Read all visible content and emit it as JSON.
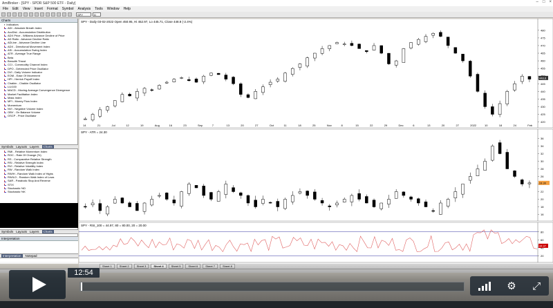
{
  "window": {
    "title": "AmiBroker - [SPY - SPDR S&P 500 ETF - Daily]"
  },
  "menu": [
    "File",
    "Edit",
    "View",
    "Insert",
    "Format",
    "Symbol",
    "Analysis",
    "Tools",
    "Window",
    "Help"
  ],
  "toolbar": {
    "symbol": "SPY",
    "period": "D"
  },
  "left_panel": {
    "header": "Charts",
    "tree_title": "Indicators",
    "indicators": [
      "ADI - Absolute Breath Index",
      "AccDist - Accumulation Distribution",
      "ADX Price - Williams Advance Decline of Price",
      "AD Ratio - Advance Decline Ratio",
      "ADLine - Advance Decline Line",
      "ADX - Directional Movement Index",
      "ASI - Accumulation Swing Index",
      "ATR - Average True Range",
      "Beta",
      "Breadth Thrust",
      "CCI - Commodity Channel Index",
      "DPO - Detrended Price Oscillator",
      "DVI - Daily Volume Indicator",
      "EOM - Ease Of Movement",
      "HPI - Herrick Payoff Index",
      "Chaikin - Chaikin Oscillator",
      "LU/100",
      "MACD - Moving Average Convergence Divergence",
      "Market Facilitation Index",
      "Mass Index",
      "MFI - Money Flow Index",
      "Momentum",
      "NVI - Negative Volume Index",
      "OBV - On Balance Volume",
      "OSCP - Price Oscillator"
    ],
    "tabs1": [
      "Symbols",
      "Layouts",
      "Layers",
      "Charts"
    ],
    "indicators2": [
      "RMI - Relative Momentum Index",
      "ROC - Rate Of Change (%)",
      "RS - Comparative Relative Strength",
      "RSI - Relative Strength Index",
      "RVI - Relative Volatility Index",
      "RW - Random Walk Index",
      "RWIH - Random Walk Index of Highs",
      "RWILO - Random Walk Index of Lows",
      "SAR - Parabolic Stop And Reverse",
      "STIX",
      "Stochastic %D",
      "Stochastic %K"
    ],
    "tabs2": [
      "Symbols",
      "Layouts",
      "Layers",
      "Charts"
    ],
    "interp_header": "Interpretation",
    "interp_tabs": [
      "Interpretation",
      "Notepad"
    ]
  },
  "chart_data": [
    {
      "type": "candlestick",
      "title": "SPY - Daily 03-02-2022 Open 450.95, Hi 452.97, Lo 445.71, Close 448.8 (-2.4%)",
      "x_ticks": [
        "14",
        "21",
        "Jul",
        "12",
        "19",
        "Aug",
        "16",
        "23",
        "Sep",
        "7",
        "13",
        "20",
        "27",
        "Oct",
        "11",
        "18",
        "25",
        "Nov",
        "8",
        "15",
        "22",
        "29",
        "Dec",
        "6",
        "13",
        "20",
        "27",
        "2022",
        "10",
        "18",
        "24",
        "Feb"
      ],
      "y_ticks": [
        480,
        475,
        470,
        465,
        460,
        455,
        450,
        445,
        440,
        435,
        430,
        425,
        420
      ],
      "last_value": "448.8",
      "ylim": [
        418,
        484
      ]
    },
    {
      "type": "candlestick",
      "title": "SPY - ATR = 24.30",
      "y_ticks": [
        36,
        34,
        32,
        30,
        28,
        26,
        24,
        22,
        20,
        18,
        16
      ],
      "last_value": "24.30",
      "ylim": [
        15,
        37
      ]
    },
    {
      "type": "line",
      "title": "SPY - RSI_100 = 44.97, 80 = 80.00, 20 = 20.00",
      "y_ticks": [
        80,
        60,
        40,
        20
      ],
      "reference_lines": [
        80,
        20
      ],
      "last_value": "44.97",
      "ylim": [
        10,
        90
      ],
      "colors": {
        "series": "#e06060",
        "ref": "#3030a0"
      }
    }
  ],
  "sheets": [
    "Sheet 1",
    "Sheet 2",
    "Sheet 3",
    "Sheet 4",
    "Sheet 5",
    "Sheet 6",
    "Sheet 7",
    "Sheet 8"
  ],
  "active_sheet": "Sheet 4",
  "player": {
    "time": "12:54",
    "progress": 0.002
  },
  "icons": {
    "play": "play-icon",
    "volume": "volume-icon",
    "settings": "gear-icon",
    "fullscreen": "fullscreen-icon"
  }
}
